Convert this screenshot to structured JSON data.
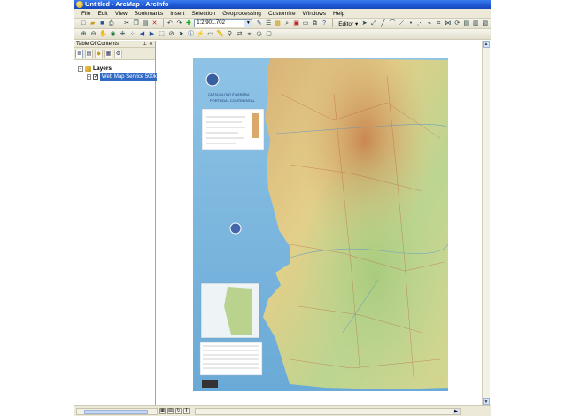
{
  "window": {
    "title": "Untitled - ArcMap - ArcInfo"
  },
  "menu": [
    "File",
    "Edit",
    "View",
    "Bookmarks",
    "Insert",
    "Selection",
    "Geoprocessing",
    "Customize",
    "Windows",
    "Help"
  ],
  "toolbar": {
    "scale_value": "1:2.901.702",
    "editor_label": "Editor ▾"
  },
  "toc": {
    "title": "Table Of Contents",
    "root_label": "Layers",
    "layer_label": "Web Map Service 500k",
    "layer_checked": true
  },
  "map": {
    "title_lines": [
      "CARTA MILITAR ITINERÁRIA",
      "PORTUGAL CONTINENTAL"
    ]
  },
  "colors": {
    "titlebar": "#1f5bd6",
    "selection": "#316ac5",
    "chrome": "#ece9d8",
    "sea": "#7fb6dd",
    "land_green": "#b9d38f",
    "land_yellow": "#e6d68c",
    "land_orange": "#d9a86a"
  }
}
